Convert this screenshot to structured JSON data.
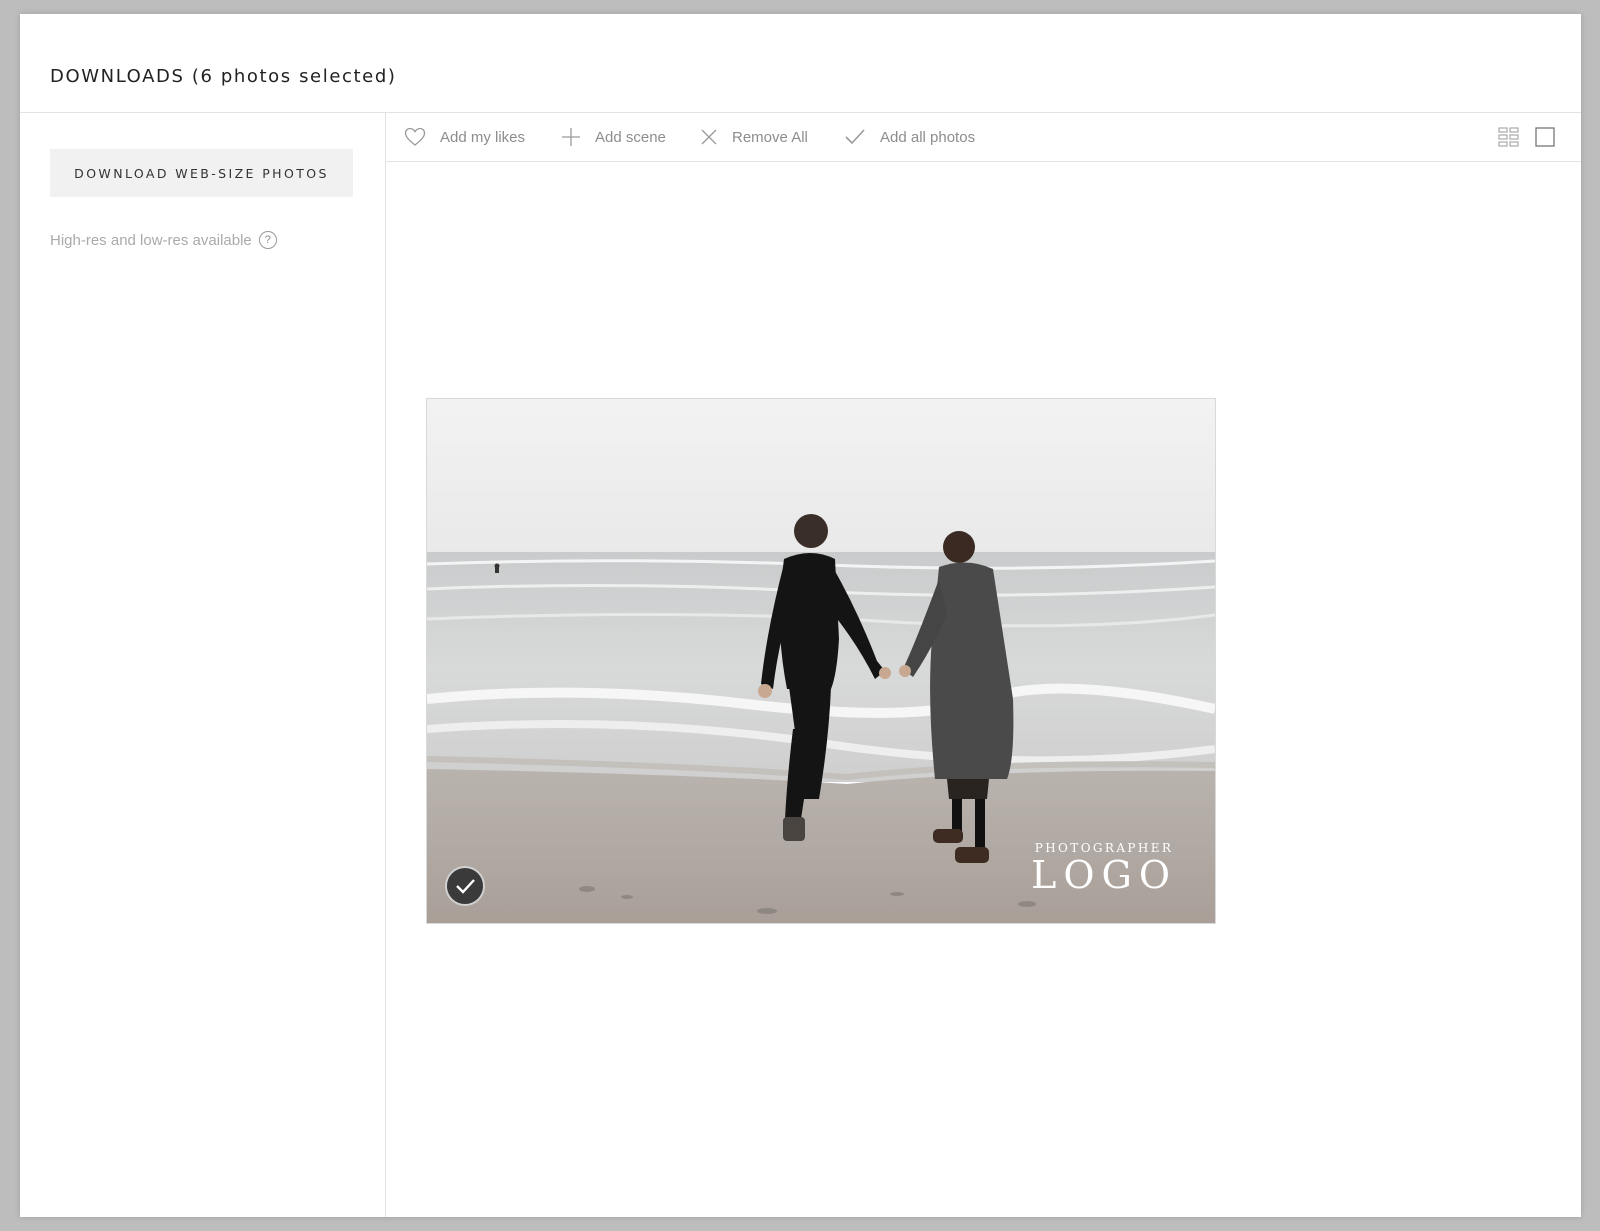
{
  "header": {
    "title": "DOWNLOADS (6 photos selected)"
  },
  "sidebar": {
    "download_button": "DOWNLOAD WEB-SIZE PHOTOS",
    "resolution_note": "High-res and low-res available",
    "help_glyph": "?"
  },
  "toolbar": {
    "add_likes": "Add my likes",
    "add_scene": "Add scene",
    "remove_all": "Remove All",
    "add_all": "Add all photos",
    "icons": {
      "add_likes": "heart-icon",
      "add_scene": "plus-icon",
      "remove_all": "x-icon",
      "add_all": "check-icon",
      "grid_view": "grid-view-icon",
      "single_view": "single-view-icon"
    }
  },
  "photo": {
    "selected": true,
    "watermark_small": "PHOTOGRAPHER",
    "watermark_big": "LOGO"
  },
  "colors": {
    "background": "#bdbdbd",
    "panel": "#ffffff",
    "muted_text": "#8d8d8d",
    "button_bg": "#f1f1f1"
  }
}
